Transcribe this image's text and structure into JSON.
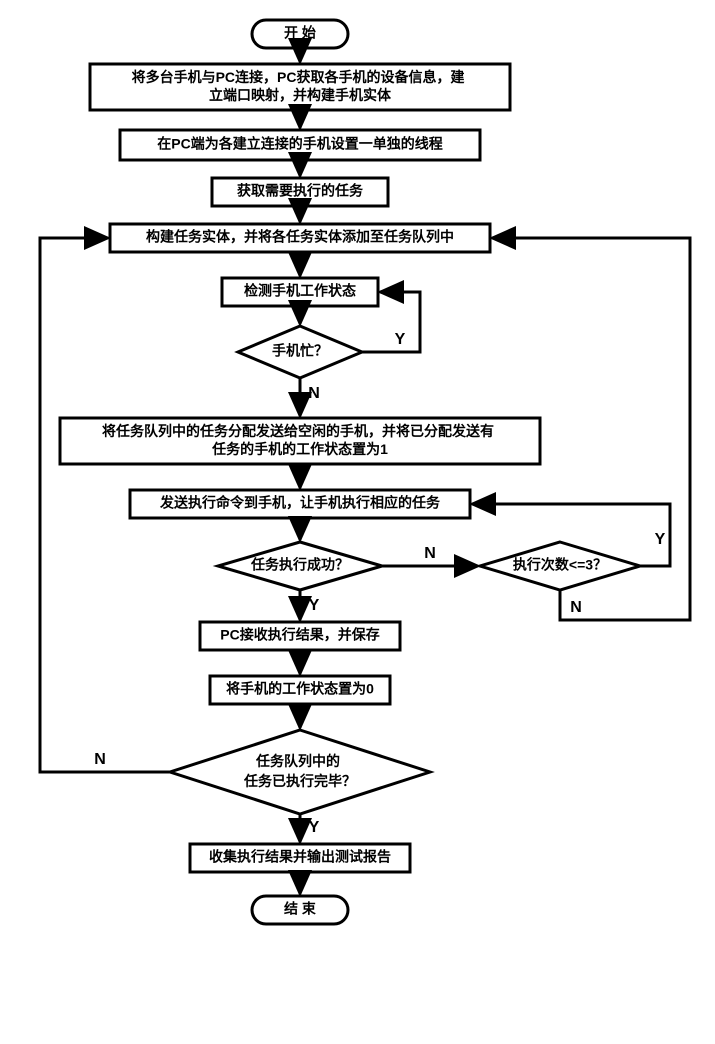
{
  "chart_data": {
    "type": "flowchart",
    "nodes": [
      {
        "id": "start",
        "kind": "terminator",
        "text": "开  始"
      },
      {
        "id": "s1",
        "kind": "process",
        "text": "将多台手机与PC连接，PC获取各手机的设备信息，建\n立端口映射，并构建手机实体"
      },
      {
        "id": "s2",
        "kind": "process",
        "text": "在PC端为各建立连接的手机设置一单独的线程"
      },
      {
        "id": "s3",
        "kind": "process",
        "text": "获取需要执行的任务"
      },
      {
        "id": "s4",
        "kind": "process",
        "text": "构建任务实体，并将各任务实体添加至任务队列中"
      },
      {
        "id": "s5",
        "kind": "process",
        "text": "检测手机工作状态"
      },
      {
        "id": "d1",
        "kind": "decision",
        "text": "手机忙？"
      },
      {
        "id": "s6",
        "kind": "process",
        "text": "将任务队列中的任务分配发送给空闲的手机，并将已分配发送有\n任务的手机的工作状态置为1"
      },
      {
        "id": "s7",
        "kind": "process",
        "text": "发送执行命令到手机，让手机执行相应的任务"
      },
      {
        "id": "d2",
        "kind": "decision",
        "text": "任务执行成功？"
      },
      {
        "id": "d3",
        "kind": "decision",
        "text": "执行次数<=3？"
      },
      {
        "id": "s8",
        "kind": "process",
        "text": "PC接收执行结果，并保存"
      },
      {
        "id": "s9",
        "kind": "process",
        "text": "将手机的工作状态置为0"
      },
      {
        "id": "d4",
        "kind": "decision",
        "text": "任务队列中的\n任务已执行完毕？"
      },
      {
        "id": "s10",
        "kind": "process",
        "text": "收集执行结果并输出测试报告"
      },
      {
        "id": "end",
        "kind": "terminator",
        "text": "结  束"
      }
    ],
    "edges": [
      {
        "from": "start",
        "to": "s1"
      },
      {
        "from": "s1",
        "to": "s2"
      },
      {
        "from": "s2",
        "to": "s3"
      },
      {
        "from": "s3",
        "to": "s4"
      },
      {
        "from": "s4",
        "to": "s5"
      },
      {
        "from": "s5",
        "to": "d1"
      },
      {
        "from": "d1",
        "to": "s5",
        "label": "Y"
      },
      {
        "from": "d1",
        "to": "s6",
        "label": "N"
      },
      {
        "from": "s6",
        "to": "s7"
      },
      {
        "from": "s7",
        "to": "d2"
      },
      {
        "from": "d2",
        "to": "s8",
        "label": "Y"
      },
      {
        "from": "d2",
        "to": "d3",
        "label": "N"
      },
      {
        "from": "d3",
        "to": "s7",
        "label": "Y"
      },
      {
        "from": "d3",
        "to": "s4",
        "label": "N"
      },
      {
        "from": "s8",
        "to": "s9"
      },
      {
        "from": "s9",
        "to": "d4"
      },
      {
        "from": "d4",
        "to": "s10",
        "label": "Y"
      },
      {
        "from": "d4",
        "to": "s4",
        "label": "N"
      },
      {
        "from": "s10",
        "to": "end"
      }
    ]
  },
  "labels": {
    "y": "Y",
    "n": "N"
  }
}
